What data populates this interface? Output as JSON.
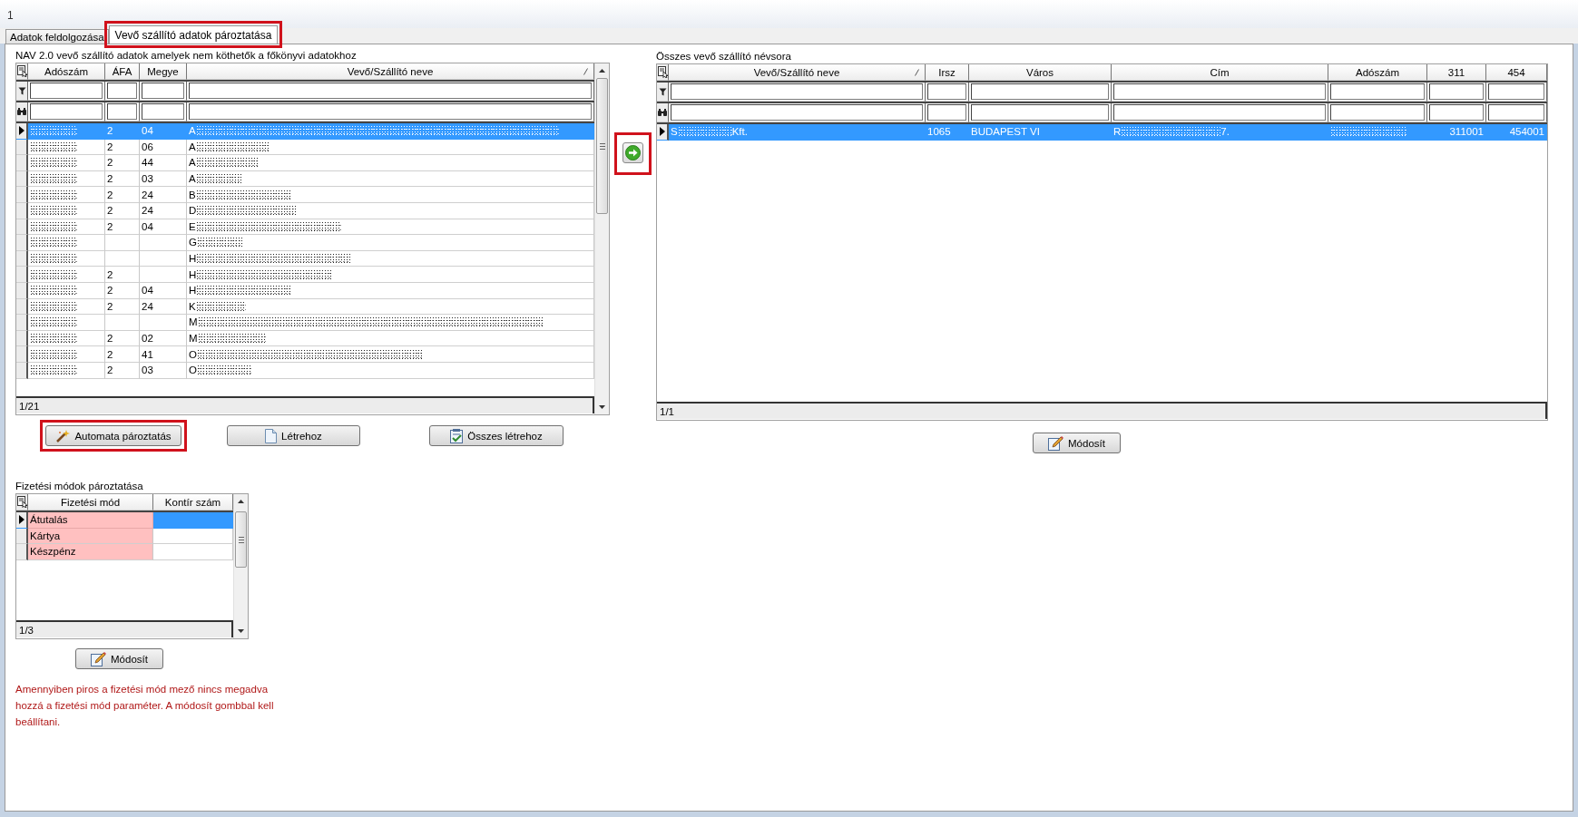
{
  "window": {
    "title": "1"
  },
  "tabs": [
    {
      "label": "Adatok feldolgozása",
      "selected": false,
      "highlighted": false
    },
    {
      "label": "Vevő szállító adatok pároztatása",
      "selected": true,
      "highlighted": true
    }
  ],
  "unmatched_grid": {
    "title": "NAV 2.0 vevő szállító adatok amelyek nem köthetők a főkönyvi adatokhoz",
    "columns": [
      "Adószám",
      "ÁFA",
      "Megye",
      "Vevő/Szállító neve"
    ],
    "rows": [
      {
        "afa": "2",
        "megye": "04",
        "name": "A",
        "selected": true
      },
      {
        "afa": "2",
        "megye": "06",
        "name": "A",
        "selected": false
      },
      {
        "afa": "2",
        "megye": "44",
        "name": "A",
        "selected": false
      },
      {
        "afa": "2",
        "megye": "03",
        "name": "A",
        "selected": false
      },
      {
        "afa": "2",
        "megye": "24",
        "name": "B",
        "selected": false
      },
      {
        "afa": "2",
        "megye": "24",
        "name": "D",
        "selected": false
      },
      {
        "afa": "2",
        "megye": "04",
        "name": "E",
        "selected": false
      },
      {
        "name": "G",
        "selected": false
      },
      {
        "name": "H",
        "selected": false
      },
      {
        "afa": "2",
        "name": "H",
        "selected": false
      },
      {
        "afa": "2",
        "megye": "04",
        "name": "H",
        "selected": false
      },
      {
        "afa": "2",
        "megye": "24",
        "name": "K",
        "selected": false
      },
      {
        "name": "M",
        "selected": false
      },
      {
        "afa": "2",
        "megye": "02",
        "name": "M",
        "selected": false
      },
      {
        "afa": "2",
        "megye": "41",
        "name": "O",
        "selected": false
      },
      {
        "afa": "2",
        "megye": "03",
        "name": "O",
        "selected": false
      }
    ],
    "record_counter": "1/21"
  },
  "actions": [
    {
      "label": "Automata pároztatás",
      "highlighted": true
    },
    {
      "label": "Létrehoz",
      "highlighted": false
    },
    {
      "label": "Összes létrehoz",
      "highlighted": false
    }
  ],
  "assign_button": {
    "highlighted": true
  },
  "partner_grid": {
    "title": "Összes vevő szállító névsora",
    "columns": [
      "Vevő/Szállító neve",
      "Irsz",
      "Város",
      "Cím",
      "Adószám",
      "311",
      "454"
    ],
    "rows": [
      {
        "name_start": "S",
        "name_end": "Kft.",
        "irsz": "1065",
        "varos": "BUDAPEST VI",
        "cim_start": "R",
        "cim_end": "7.",
        "col_311": "311001",
        "col_454": "454001",
        "selected": true
      }
    ],
    "record_counter": "1/1",
    "button": {
      "label": "Módosít"
    }
  },
  "payment_grid": {
    "title": "Fizetési módok pároztatása",
    "columns": [
      "Fizetési mód",
      "Kontír szám"
    ],
    "rows": [
      {
        "mode": "Átutalás",
        "missing": true,
        "selected": true
      },
      {
        "mode": "Kártya",
        "missing": true,
        "selected": false
      },
      {
        "mode": "Készpénz",
        "missing": true,
        "selected": false
      }
    ],
    "record_counter": "1/3",
    "button": {
      "label": "Módosít"
    }
  },
  "note": "Amennyiben piros a fizetési mód mező nincs megadva hozzá a fizetési mód paraméter. A módosít gombbal kell beállítani."
}
